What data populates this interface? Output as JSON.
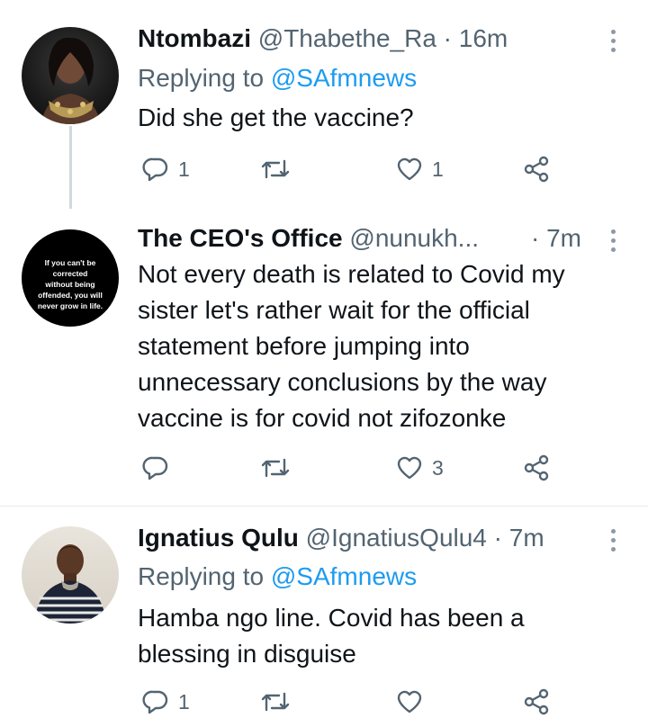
{
  "tweets": [
    {
      "name": "Ntombazi",
      "handle": "@Thabethe_Ra",
      "time": "· 16m",
      "replying_prefix": "Replying to",
      "replying_to": "@SAfmnews",
      "text": [
        "Did she get the vaccine?"
      ],
      "replies": "1",
      "likes": "1"
    },
    {
      "name": "The CEO's Office",
      "handle": "@nunukh...",
      "time": "· 7m",
      "avatar_text": [
        "If you can't be",
        "corrected",
        "without being",
        "offended, you will",
        "never grow in life."
      ],
      "text": [
        "Not every death is related to Covid my",
        "sister let's rather wait for the official",
        "statement before jumping into",
        "unnecessary conclusions by the way",
        "vaccine is for covid not zifozonke"
      ],
      "replies": "",
      "likes": "3"
    },
    {
      "name": "Ignatius Qulu",
      "handle": "@IgnatiusQulu4",
      "time": "· 7m",
      "replying_prefix": "Replying to",
      "replying_to": "@SAfmnews",
      "text": [
        "Hamba ngo line. Covid has been a",
        "blessing in disguise"
      ],
      "replies": "1",
      "likes": ""
    }
  ],
  "colors": {
    "text": "#0f1419",
    "secondary": "#536471",
    "link": "#1d9bf0",
    "thread_line": "#cfd9de"
  }
}
